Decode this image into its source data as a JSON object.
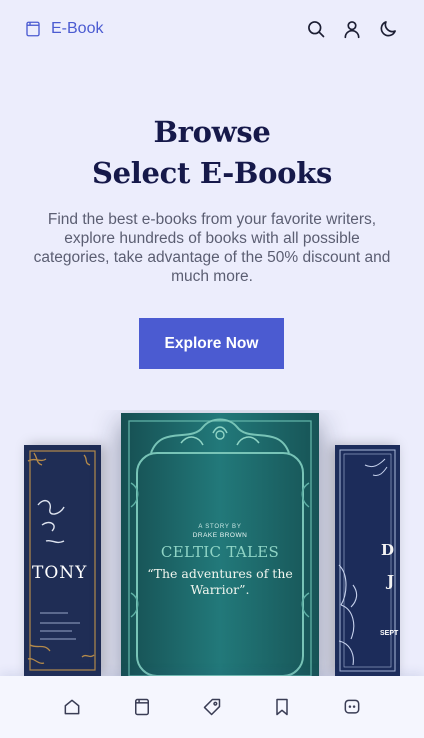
{
  "header": {
    "brand": "E-Book",
    "icons": [
      "book-icon",
      "search-icon",
      "user-icon",
      "moon-icon"
    ]
  },
  "hero": {
    "title_line1": "Browse",
    "title_line2": "Select E-Books",
    "description": "Find the best e-books from your favorite writers, explore hundreds of books with all possible categories, take advantage of the 50% discount and much more.",
    "cta_label": "Explore Now"
  },
  "books": {
    "left": {
      "text": "TONY"
    },
    "center": {
      "byline": "A STORY BY",
      "author": "DRAKE BROWN",
      "title": "CELTIC TALES",
      "subtitle": "“The adventures of the Warrior”."
    },
    "right": {
      "line1": "D",
      "line2": "J",
      "line3": "SEPT"
    }
  },
  "bottom_nav": {
    "items": [
      "home-icon",
      "book-icon",
      "tag-icon",
      "bookmark-icon",
      "chat-icon"
    ]
  },
  "colors": {
    "background": "#ecedfc",
    "accent": "#4b5bd1",
    "title": "#16194a",
    "text": "#5b5e72"
  }
}
